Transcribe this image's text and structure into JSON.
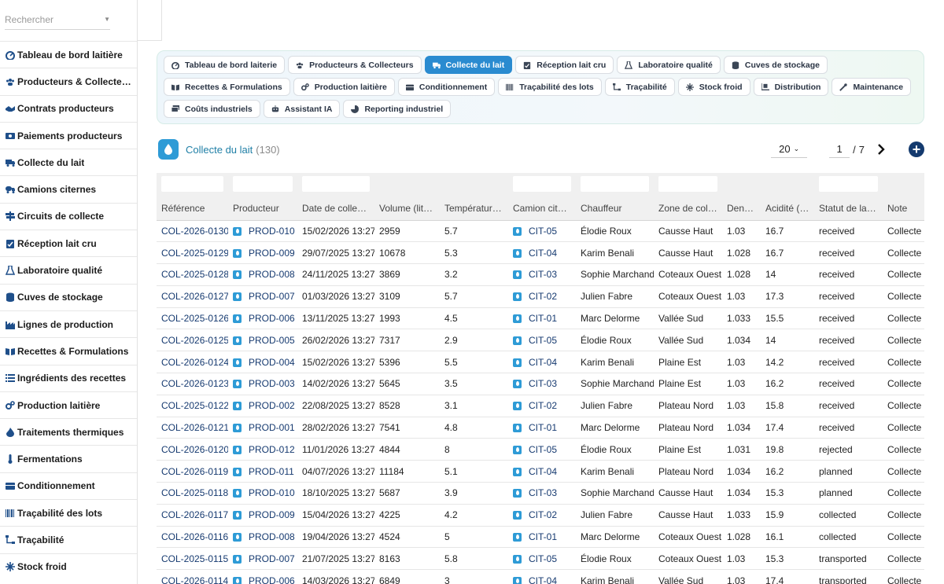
{
  "search": {
    "placeholder": "Rechercher"
  },
  "sidebar": {
    "items": [
      {
        "label": "Tableau de bord laitière",
        "icon": "dashboard-icon"
      },
      {
        "label": "Producteurs & Collecteurs",
        "icon": "users-icon"
      },
      {
        "label": "Contrats producteurs",
        "icon": "handshake-icon"
      },
      {
        "label": "Paiements producteurs",
        "icon": "money-icon"
      },
      {
        "label": "Collecte du lait",
        "icon": "truck-icon"
      },
      {
        "label": "Camions citernes",
        "icon": "tanker-truck-icon"
      },
      {
        "label": "Circuits de collecte",
        "icon": "route-sign-icon"
      },
      {
        "label": "Réception lait cru",
        "icon": "clipboard-check-icon"
      },
      {
        "label": "Laboratoire qualité",
        "icon": "flask-icon"
      },
      {
        "label": "Cuves de stockage",
        "icon": "database-icon"
      },
      {
        "label": "Lignes de production",
        "icon": "industry-icon"
      },
      {
        "label": "Recettes & Formulations",
        "icon": "book-open-icon"
      },
      {
        "label": "Ingrédients des recettes",
        "icon": "list-icon"
      },
      {
        "label": "Production laitière",
        "icon": "cogs-icon"
      },
      {
        "label": "Traitements thermiques",
        "icon": "fire-icon"
      },
      {
        "label": "Fermentations",
        "icon": "thermometer-icon"
      },
      {
        "label": "Conditionnement",
        "icon": "box-icon"
      },
      {
        "label": "Traçabilité des lots",
        "icon": "barcode-icon"
      },
      {
        "label": "Traçabilité",
        "icon": "sitemap-icon"
      },
      {
        "label": "Stock froid",
        "icon": "snowflake-icon"
      }
    ]
  },
  "nav": {
    "tabs": [
      {
        "label": "Tableau de bord laiterie",
        "icon": "dashboard-icon",
        "active": false
      },
      {
        "label": "Producteurs & Collecteurs",
        "icon": "users-icon",
        "active": false
      },
      {
        "label": "Collecte du lait",
        "icon": "truck-icon",
        "active": true
      },
      {
        "label": "Réception lait cru",
        "icon": "clipboard-check-icon",
        "active": false
      },
      {
        "label": "Laboratoire qualité",
        "icon": "flask-icon",
        "active": false
      },
      {
        "label": "Cuves de stockage",
        "icon": "database-icon",
        "active": false
      },
      {
        "label": "Recettes & Formulations",
        "icon": "book-open-icon",
        "active": false
      },
      {
        "label": "Production laitière",
        "icon": "cogs-icon",
        "active": false
      },
      {
        "label": "Conditionnement",
        "icon": "box-icon",
        "active": false
      },
      {
        "label": "Traçabilité des lots",
        "icon": "barcode-icon",
        "active": false
      },
      {
        "label": "Traçabilité",
        "icon": "sitemap-icon",
        "active": false
      },
      {
        "label": "Stock froid",
        "icon": "snowflake-icon",
        "active": false
      },
      {
        "label": "Distribution",
        "icon": "truck-loading-icon",
        "active": false
      },
      {
        "label": "Maintenance",
        "icon": "wrench-icon",
        "active": false
      },
      {
        "label": "Coûts industriels",
        "icon": "money-bills-icon",
        "active": false
      },
      {
        "label": "Assistant IA",
        "icon": "robot-icon",
        "active": false
      },
      {
        "label": "Reporting industriel",
        "icon": "pie-chart-icon",
        "active": false
      }
    ]
  },
  "section": {
    "title": "Collecte du lait",
    "count": "(130)"
  },
  "pager": {
    "per_page": "20",
    "page": "1",
    "separator": "/",
    "total_pages": "7"
  },
  "table": {
    "columns": [
      "Référence",
      "Producteur",
      "Date de collecte",
      "Volume (litres)",
      "Température (°C)",
      "Camion citerne",
      "Chauffeur",
      "Zone de collecte",
      "Densité",
      "Acidité (°D)",
      "Statut de la collecte",
      "Note"
    ],
    "rows": [
      [
        "COL-2026-0130",
        "PROD-010",
        "15/02/2026 13:27",
        "2959",
        "5.7",
        "CIT-05",
        "Élodie Roux",
        "Causse Haut",
        "1.03",
        "16.7",
        "received",
        "Collecte d"
      ],
      [
        "COL-2025-0129",
        "PROD-009",
        "29/07/2025 13:27",
        "10678",
        "5.3",
        "CIT-04",
        "Karim Benali",
        "Causse Haut",
        "1.028",
        "16.7",
        "received",
        "Collecte d"
      ],
      [
        "COL-2025-0128",
        "PROD-008",
        "24/11/2025 13:27",
        "3869",
        "3.2",
        "CIT-03",
        "Sophie Marchand",
        "Coteaux Ouest",
        "1.028",
        "14",
        "received",
        "Collecte d"
      ],
      [
        "COL-2026-0127",
        "PROD-007",
        "01/03/2026 13:27",
        "3109",
        "5.7",
        "CIT-02",
        "Julien Fabre",
        "Coteaux Ouest",
        "1.03",
        "17.3",
        "received",
        "Collecte d"
      ],
      [
        "COL-2025-0126",
        "PROD-006",
        "13/11/2025 13:27",
        "1993",
        "4.5",
        "CIT-01",
        "Marc Delorme",
        "Vallée Sud",
        "1.033",
        "15.5",
        "received",
        "Collecte d"
      ],
      [
        "COL-2026-0125",
        "PROD-005",
        "26/02/2026 13:27",
        "7317",
        "2.9",
        "CIT-05",
        "Élodie Roux",
        "Vallée Sud",
        "1.034",
        "14",
        "received",
        "Collecte d"
      ],
      [
        "COL-2026-0124",
        "PROD-004",
        "15/02/2026 13:27",
        "5396",
        "5.5",
        "CIT-04",
        "Karim Benali",
        "Plaine Est",
        "1.03",
        "14.2",
        "received",
        "Collecte d"
      ],
      [
        "COL-2026-0123",
        "PROD-003",
        "14/02/2026 13:27",
        "5645",
        "3.5",
        "CIT-03",
        "Sophie Marchand",
        "Plaine Est",
        "1.03",
        "16.2",
        "received",
        "Collecte d"
      ],
      [
        "COL-2025-0122",
        "PROD-002",
        "22/08/2025 13:27",
        "8528",
        "3.1",
        "CIT-02",
        "Julien Fabre",
        "Plateau Nord",
        "1.03",
        "15.8",
        "received",
        "Collecte d"
      ],
      [
        "COL-2026-0121",
        "PROD-001",
        "28/02/2026 13:27",
        "7541",
        "4.8",
        "CIT-01",
        "Marc Delorme",
        "Plateau Nord",
        "1.034",
        "17.4",
        "received",
        "Collecte d"
      ],
      [
        "COL-2026-0120",
        "PROD-012",
        "11/01/2026 13:27",
        "4844",
        "8",
        "CIT-05",
        "Élodie Roux",
        "Plaine Est",
        "1.031",
        "19.8",
        "rejected",
        "Collecte d"
      ],
      [
        "COL-2026-0119",
        "PROD-011",
        "04/07/2026 13:27",
        "11184",
        "5.1",
        "CIT-04",
        "Karim Benali",
        "Plateau Nord",
        "1.034",
        "16.2",
        "planned",
        "Collecte d"
      ],
      [
        "COL-2025-0118",
        "PROD-010",
        "18/10/2025 13:27",
        "5687",
        "3.9",
        "CIT-03",
        "Sophie Marchand",
        "Causse Haut",
        "1.034",
        "15.3",
        "planned",
        "Collecte d"
      ],
      [
        "COL-2026-0117",
        "PROD-009",
        "15/04/2026 13:27",
        "4225",
        "4.2",
        "CIT-02",
        "Julien Fabre",
        "Causse Haut",
        "1.033",
        "15.9",
        "collected",
        "Collecte d"
      ],
      [
        "COL-2026-0116",
        "PROD-008",
        "19/04/2026 13:27",
        "4524",
        "5",
        "CIT-01",
        "Marc Delorme",
        "Coteaux Ouest",
        "1.028",
        "16.1",
        "collected",
        "Collecte d"
      ],
      [
        "COL-2025-0115",
        "PROD-007",
        "21/07/2025 13:27",
        "8163",
        "5.8",
        "CIT-05",
        "Élodie Roux",
        "Coteaux Ouest",
        "1.03",
        "15.3",
        "transported",
        "Collecte d"
      ],
      [
        "COL-2026-0114",
        "PROD-006",
        "14/03/2026 13:27",
        "6849",
        "3",
        "CIT-04",
        "Karim Benali",
        "Vallée Sud",
        "1.03",
        "17.4",
        "transported",
        "Collecte d"
      ]
    ]
  },
  "colors": {
    "accent": "#2a8bd0",
    "link": "#163a70",
    "title": "#1f7fa6",
    "add_button": "#143a6e"
  }
}
